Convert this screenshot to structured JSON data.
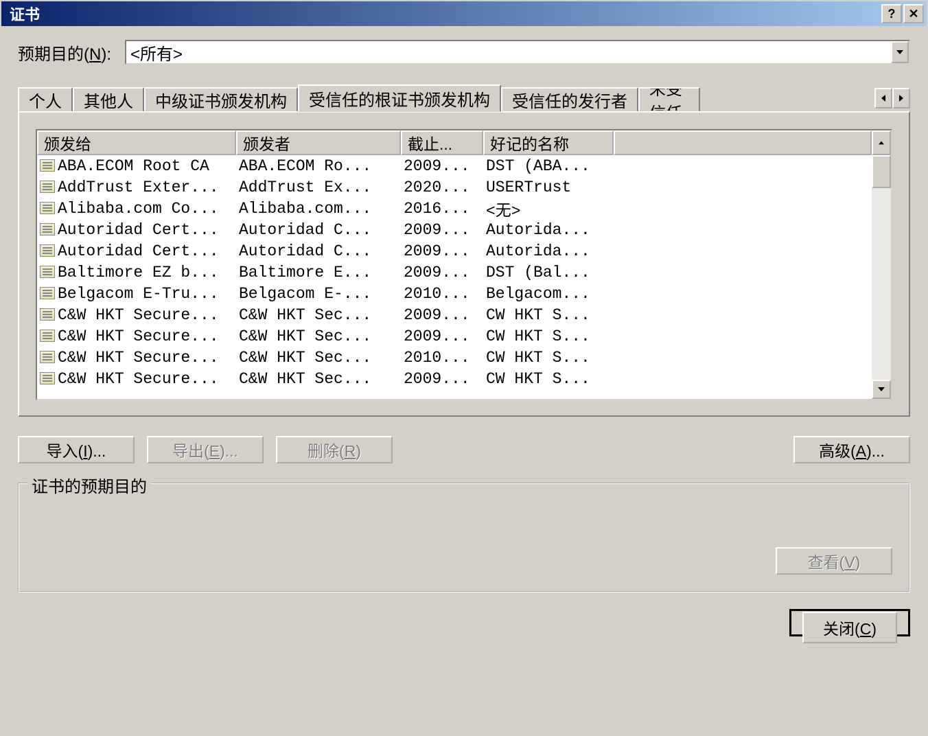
{
  "window": {
    "title": "证书"
  },
  "purpose": {
    "label_prefix": "预期目的(",
    "label_key": "N",
    "label_suffix": "):",
    "value": "<所有>"
  },
  "tabs": {
    "items": [
      {
        "label": "个人"
      },
      {
        "label": "其他人"
      },
      {
        "label": "中级证书颁发机构"
      },
      {
        "label": "受信任的根证书颁发机构"
      },
      {
        "label": "受信任的发行者"
      },
      {
        "label": "未受信任"
      }
    ],
    "active_index": 3
  },
  "table": {
    "headers": {
      "issued_to": "颁发给",
      "issued_by": "颁发者",
      "expiry": "截止...",
      "friendly_name": "好记的名称"
    },
    "rows": [
      {
        "issued_to": "ABA.ECOM Root CA",
        "issued_by": "ABA.ECOM Ro...",
        "expiry": "2009...",
        "friendly_name": "DST (ABA..."
      },
      {
        "issued_to": "AddTrust Exter...",
        "issued_by": "AddTrust Ex...",
        "expiry": "2020...",
        "friendly_name": "USERTrust"
      },
      {
        "issued_to": "Alibaba.com Co...",
        "issued_by": "Alibaba.com...",
        "expiry": "2016...",
        "friendly_name": "<无>"
      },
      {
        "issued_to": "Autoridad Cert...",
        "issued_by": "Autoridad C...",
        "expiry": "2009...",
        "friendly_name": "Autorida..."
      },
      {
        "issued_to": "Autoridad Cert...",
        "issued_by": "Autoridad C...",
        "expiry": "2009...",
        "friendly_name": "Autorida..."
      },
      {
        "issued_to": "Baltimore EZ b...",
        "issued_by": "Baltimore E...",
        "expiry": "2009...",
        "friendly_name": "DST (Bal..."
      },
      {
        "issued_to": "Belgacom E-Tru...",
        "issued_by": "Belgacom E-...",
        "expiry": "2010...",
        "friendly_name": "Belgacom..."
      },
      {
        "issued_to": "C&W HKT Secure...",
        "issued_by": "C&W HKT Sec...",
        "expiry": "2009...",
        "friendly_name": "CW HKT S..."
      },
      {
        "issued_to": "C&W HKT Secure...",
        "issued_by": "C&W HKT Sec...",
        "expiry": "2009...",
        "friendly_name": "CW HKT S..."
      },
      {
        "issued_to": "C&W HKT Secure...",
        "issued_by": "C&W HKT Sec...",
        "expiry": "2010...",
        "friendly_name": "CW HKT S..."
      },
      {
        "issued_to": "C&W HKT Secure...",
        "issued_by": "C&W HKT Sec...",
        "expiry": "2009...",
        "friendly_name": "CW HKT S..."
      }
    ]
  },
  "buttons": {
    "import_prefix": "导入(",
    "import_key": "I",
    "import_suffix": ")...",
    "export_prefix": "导出(",
    "export_key": "E",
    "export_suffix": ")...",
    "delete_prefix": "删除(",
    "delete_key": "R",
    "delete_suffix": ")",
    "advanced_prefix": "高级(",
    "advanced_key": "A",
    "advanced_suffix": ")...",
    "view_prefix": "查看(",
    "view_key": "V",
    "view_suffix": ")",
    "close_prefix": "关闭(",
    "close_key": "C",
    "close_suffix": ")"
  },
  "groupbox": {
    "label": "证书的预期目的"
  }
}
